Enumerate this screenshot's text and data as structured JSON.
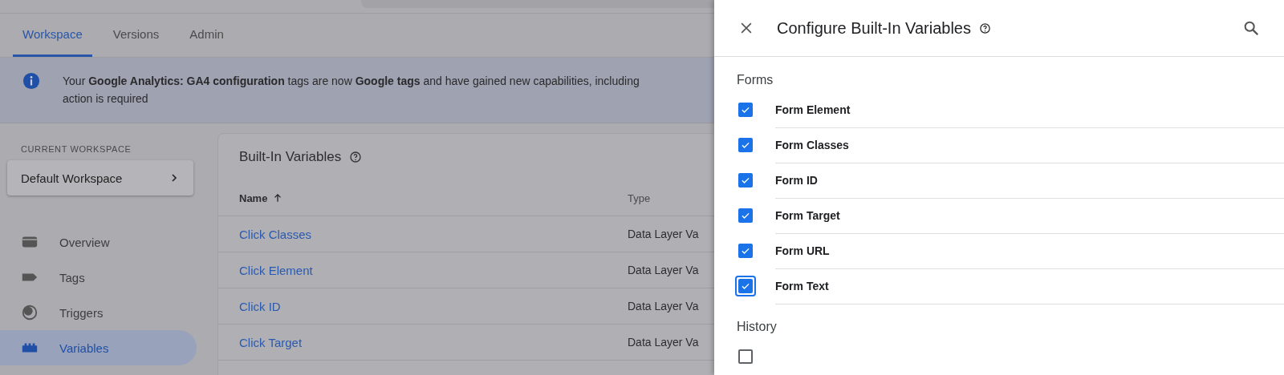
{
  "tabs": [
    {
      "label": "Workspace",
      "selected": true
    },
    {
      "label": "Versions",
      "selected": false
    },
    {
      "label": "Admin",
      "selected": false
    }
  ],
  "banner": {
    "lines": [
      "Your **Google Analytics: GA4 configuration** tags are now **Google tags** and have gained new capabilities, including",
      "action is required"
    ]
  },
  "sidebar": {
    "section_label": "CURRENT WORKSPACE",
    "workspace": "Default Workspace",
    "items": [
      {
        "kind": "overview",
        "label": "Overview",
        "selected": false
      },
      {
        "kind": "tags",
        "label": "Tags",
        "selected": false
      },
      {
        "kind": "triggers",
        "label": "Triggers",
        "selected": false
      },
      {
        "kind": "variables",
        "label": "Variables",
        "selected": true
      }
    ]
  },
  "card": {
    "title": "Built-In Variables",
    "columns": [
      "Name",
      "Type"
    ],
    "rows": [
      {
        "name": "Click Classes",
        "type": "Data Layer Va"
      },
      {
        "name": "Click Element",
        "type": "Data Layer Va"
      },
      {
        "name": "Click ID",
        "type": "Data Layer Va"
      },
      {
        "name": "Click Target",
        "type": "Data Layer Va"
      }
    ]
  },
  "panel": {
    "title": "Configure Built-In Variables",
    "sections": [
      {
        "title": "Forms",
        "items": [
          {
            "label": "Form Element",
            "checked": true,
            "focused": false
          },
          {
            "label": "Form Classes",
            "checked": true,
            "focused": false
          },
          {
            "label": "Form ID",
            "checked": true,
            "focused": false
          },
          {
            "label": "Form Target",
            "checked": true,
            "focused": false
          },
          {
            "label": "Form URL",
            "checked": true,
            "focused": false
          },
          {
            "label": "Form Text",
            "checked": true,
            "focused": true
          }
        ]
      },
      {
        "title": "History",
        "items": [
          {
            "checked": false,
            "focused": false
          }
        ]
      }
    ]
  }
}
